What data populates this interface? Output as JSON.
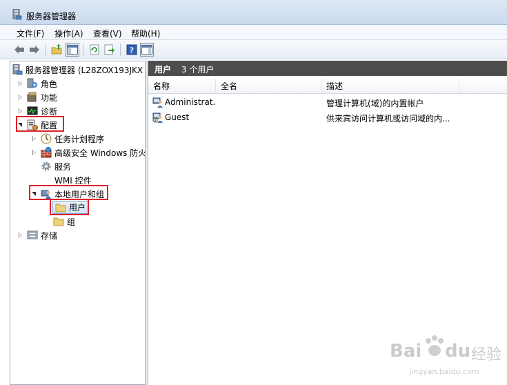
{
  "window": {
    "title": "服务器管理器"
  },
  "menu": {
    "items": [
      "文件(F)",
      "操作(A)",
      "查看(V)",
      "帮助(H)"
    ]
  },
  "toolbar": {
    "buttons": [
      "back-icon",
      "forward-icon",
      "up-folder-icon",
      "show-hide-tree-icon",
      "refresh-icon",
      "export-icon",
      "help-icon",
      "show-hide-action-pane-icon"
    ]
  },
  "tree": {
    "root": "服务器管理器 (L28ZOX193JKX",
    "roles": "角色",
    "features": "功能",
    "diagnostics": "诊断",
    "configuration": "配置",
    "task_scheduler": "任务计划程序",
    "firewall": "高级安全 Windows 防火",
    "services": "服务",
    "wmi": "WMI 控件",
    "local_users_groups": "本地用户和组",
    "users": "用户",
    "groups": "组",
    "storage": "存储"
  },
  "list": {
    "title": "用户",
    "count": "3 个用户",
    "columns": [
      "名称",
      "全名",
      "描述"
    ],
    "rows": [
      {
        "name": "Administrat...",
        "full_name": "",
        "description": "管理计算机(域)的内置帐户"
      },
      {
        "name": "Guest",
        "full_name": "",
        "description": "供来宾访问计算机或访问域的内..."
      }
    ]
  },
  "watermark": {
    "brand": "Bai",
    "brand2": "du",
    "brand_cn": "经验",
    "url": "jingyan.baidu.com"
  },
  "colors": {
    "highlight": "#e0212b",
    "header_bg": "#4d4d4d"
  }
}
